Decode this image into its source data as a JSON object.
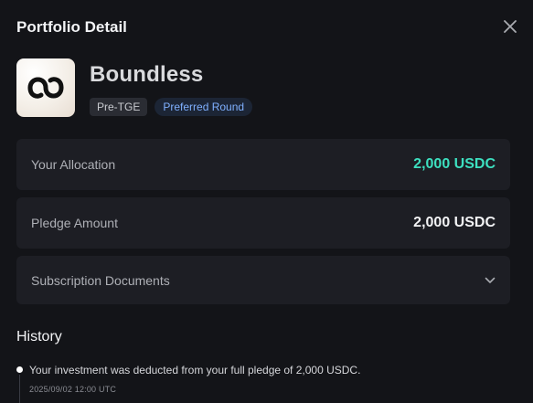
{
  "modal": {
    "title": "Portfolio Detail"
  },
  "project": {
    "name": "Boundless",
    "badges": [
      "Pre-TGE",
      "Preferred Round"
    ]
  },
  "allocation": {
    "label": "Your Allocation",
    "value": "2,000 USDC",
    "value_color": "#3de0c0"
  },
  "pledge": {
    "label": "Pledge Amount",
    "value": "2,000 USDC"
  },
  "documents": {
    "label": "Subscription Documents"
  },
  "history": {
    "title": "History",
    "items": [
      {
        "text": "Your investment was deducted from your full pledge of 2,000 USDC.",
        "time": "2025/09/02 12:00 UTC"
      }
    ]
  },
  "icons": {
    "close": "close-icon",
    "logo": "boundless-logo-icon",
    "dropdown": "chevron-down-icon"
  }
}
